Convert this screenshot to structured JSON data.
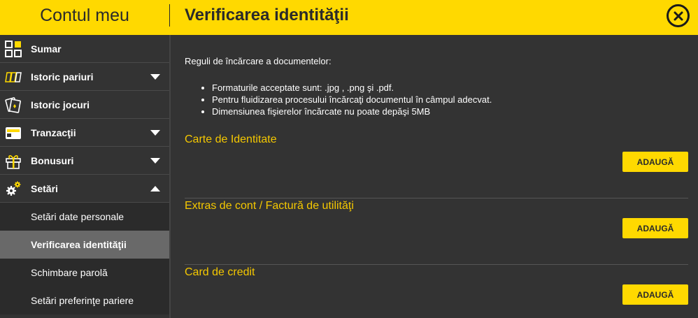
{
  "header": {
    "left_title": "Contul meu",
    "main_title": "Verificarea identităţii"
  },
  "sidebar": {
    "items": [
      {
        "label": "Sumar",
        "icon": "grid-icon"
      },
      {
        "label": "Istoric pariuri",
        "icon": "tickets-icon"
      },
      {
        "label": "Istoric jocuri",
        "icon": "cards-icon"
      },
      {
        "label": "Tranzacţii",
        "icon": "wallet-icon"
      },
      {
        "label": "Bonusuri",
        "icon": "gift-icon"
      },
      {
        "label": "Setări",
        "icon": "gears-icon"
      }
    ],
    "sub_items": [
      {
        "label": "Setări date personale"
      },
      {
        "label": "Verificarea identităţii"
      },
      {
        "label": "Schimbare parolă"
      },
      {
        "label": "Setări preferinţe pariere"
      }
    ]
  },
  "main": {
    "rules_title": "Reguli de încărcare a documentelor:",
    "rules": [
      "Formaturile acceptate sunt: .jpg , .png şi .pdf.",
      "Pentru fluidizarea procesului încărcaţi documentul în câmpul adecvat.",
      "Dimensiunea fişierelor încărcate nu poate depăşi 5MB"
    ],
    "sections": [
      {
        "title": "Carte de Identitate",
        "button": "ADAUGĂ"
      },
      {
        "title": "Extras de cont / Factură de utilităţi",
        "button": "ADAUGĂ"
      },
      {
        "title": "Card de credit",
        "button": "ADAUGĂ"
      }
    ]
  },
  "colors": {
    "accent": "#ffd900",
    "background": "#333333",
    "active_item": "#696969",
    "section_title": "#f5c800"
  }
}
